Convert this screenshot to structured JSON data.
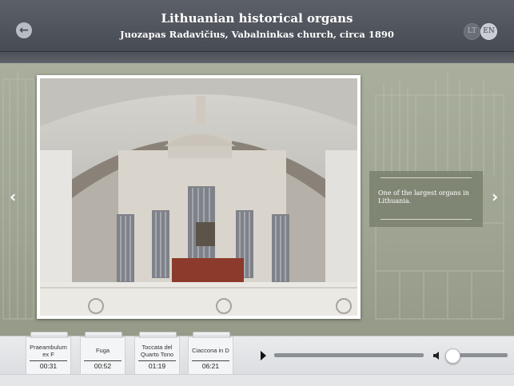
{
  "header": {
    "title": "Lithuanian historical organs",
    "subtitle": "Juozapas Radavičius, Vabalninkas church, circa 1890",
    "back_icon": "back-arrow-icon",
    "languages": [
      "LT",
      "EN"
    ],
    "active_language": "EN"
  },
  "gallery": {
    "caption": "One of the largest organs in Lithuania.",
    "prev_icon": "chevron-left-icon",
    "next_icon": "chevron-right-icon"
  },
  "tracks": [
    {
      "name": "Praeambulum ex F",
      "duration": "00:31"
    },
    {
      "name": "Fuga",
      "duration": "00:52"
    },
    {
      "name": "Toccata del Quarto Tono",
      "duration": "01:19"
    },
    {
      "name": "Ciaccona in D",
      "duration": "06:21"
    }
  ],
  "player": {
    "play_icon": "play-icon",
    "progress": 0,
    "volume_icon": "speaker-icon",
    "volume": 0.1
  },
  "colors": {
    "header": "#4f535b",
    "background": "#a3a996",
    "accent": "#ffffff"
  }
}
